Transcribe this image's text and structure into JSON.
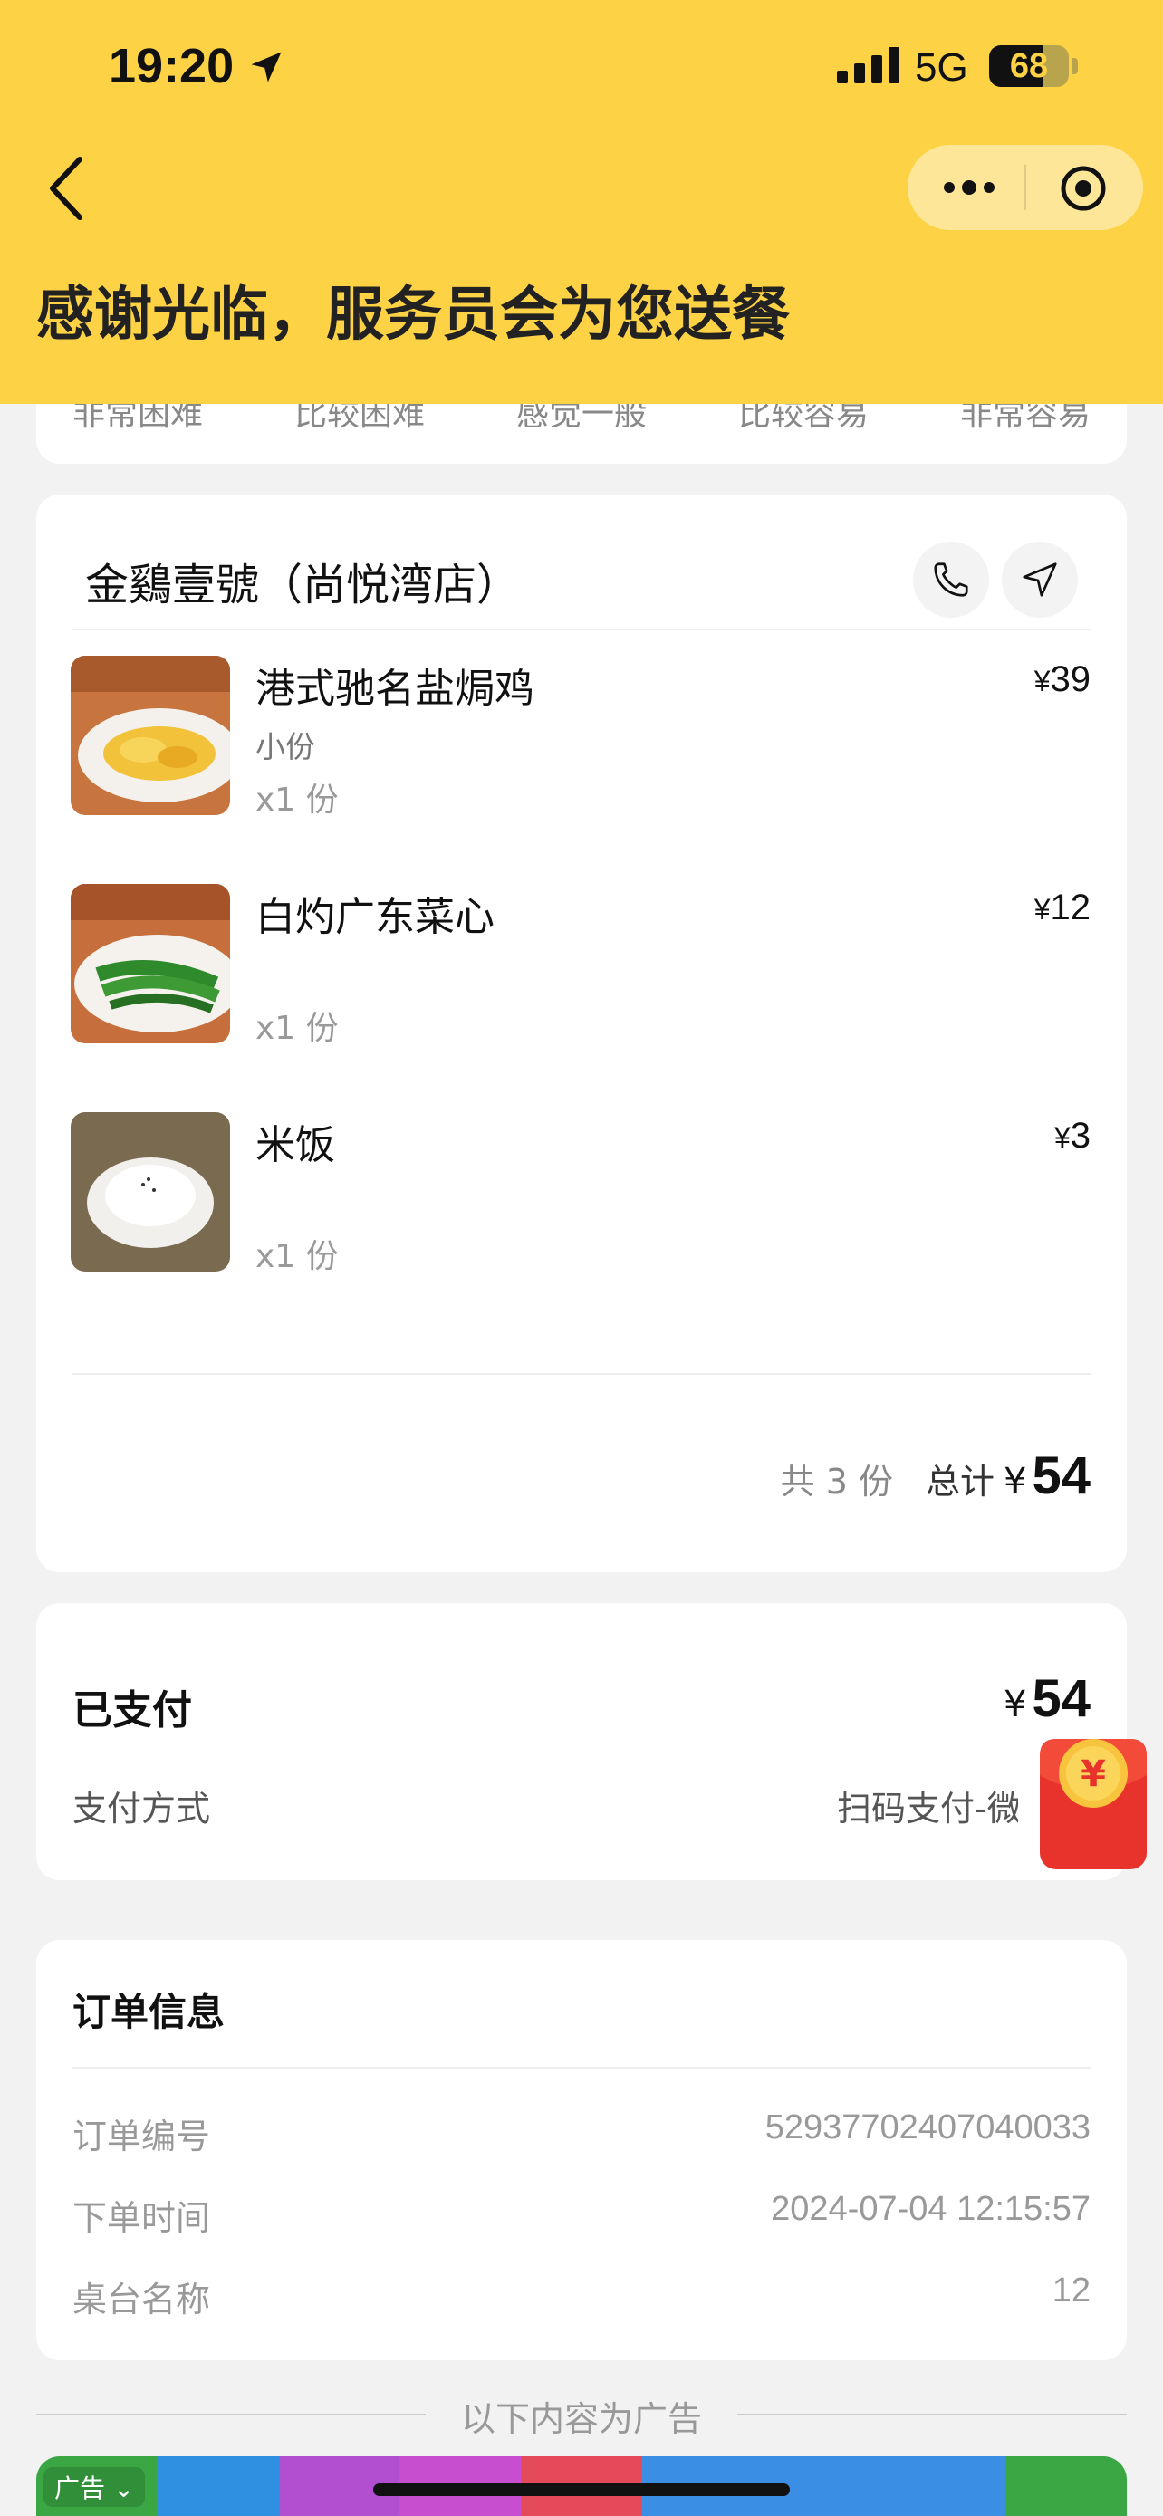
{
  "status_bar": {
    "time": "19:20",
    "network": "5G",
    "battery": "68",
    "battery_level": 0.68
  },
  "header": {
    "title": "感谢光临，服务员会为您送餐"
  },
  "rating_row": [
    "非常困难",
    "比较困难",
    "感觉一般",
    "比较容易",
    "非常容易"
  ],
  "store": {
    "name": "金鷄壹號（尚悦湾店）"
  },
  "items": [
    {
      "name": "港式驰名盐焗鸡",
      "spec": "小份",
      "qty": "x1 份",
      "currency": "¥",
      "price": "39"
    },
    {
      "name": "白灼广东菜心",
      "spec": "",
      "qty": "x1 份",
      "currency": "¥",
      "price": "12"
    },
    {
      "name": "米饭",
      "spec": "",
      "qty": "x1 份",
      "currency": "¥",
      "price": "3"
    }
  ],
  "totals": {
    "count": "共 3 份",
    "label": "总计",
    "currency": "¥",
    "amount": "54"
  },
  "payment": {
    "label": "已支付",
    "currency": "¥",
    "amount": "54",
    "method_label": "支付方式",
    "method_value": "扫码支付-微"
  },
  "order_info": {
    "title": "订单信息",
    "rows": [
      {
        "label": "订单编号",
        "value": "52937702407040033"
      },
      {
        "label": "下单时间",
        "value": "2024-07-04 12:15:57"
      },
      {
        "label": "桌台名称",
        "value": "12"
      }
    ]
  },
  "ad": {
    "separator": "以下内容为广告",
    "tag": "广告"
  },
  "colors": {
    "header_bg": "#fdd245",
    "page_bg": "#f2f2f2",
    "card_bg": "#ffffff",
    "redpacket": "#e8322c"
  }
}
